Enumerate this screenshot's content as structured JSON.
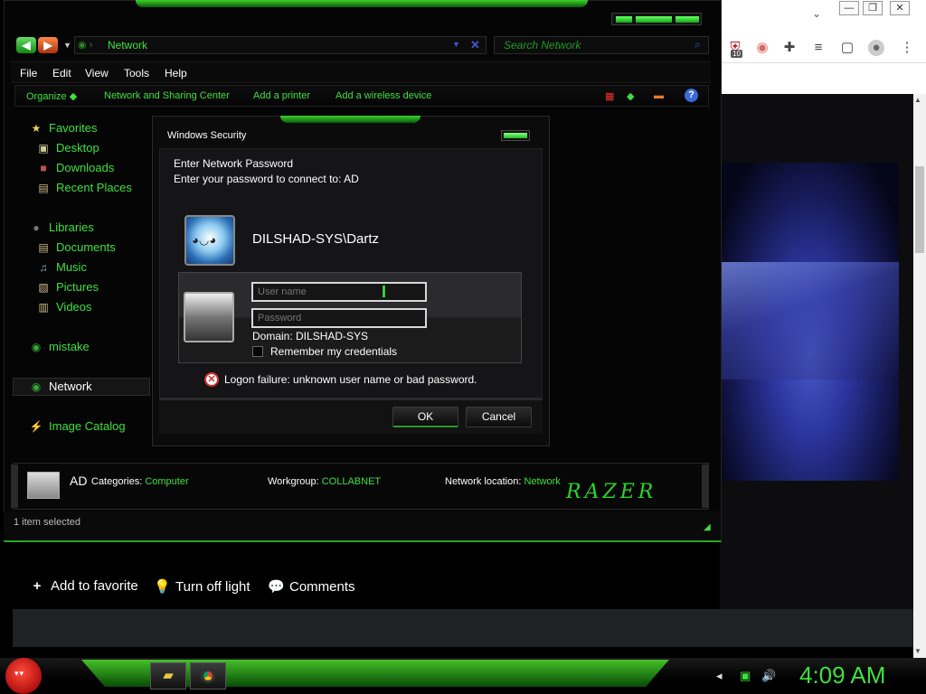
{
  "browser": {
    "window_controls": {
      "minimize": "—",
      "restore": "❐",
      "close": "✕"
    },
    "extension_badge": "10",
    "scroll_up": "▲",
    "scroll_down": "▼",
    "page_actions": {
      "add_favorite": "Add to favorite",
      "turn_off_light": "Turn off light",
      "comments": "Comments"
    }
  },
  "explorer": {
    "address": "Network",
    "search_placeholder": "Search Network",
    "menus": [
      "File",
      "Edit",
      "View",
      "Tools",
      "Help"
    ],
    "commands": [
      "Organize",
      "Network and Sharing Center",
      "Add a printer",
      "Add a wireless device"
    ],
    "help_icon": "?",
    "sidebar": {
      "favorites": "Favorites",
      "desktop": "Desktop",
      "downloads": "Downloads",
      "recent": "Recent Places",
      "libraries": "Libraries",
      "documents": "Documents",
      "music": "Music",
      "pictures": "Pictures",
      "videos": "Videos",
      "homegroup_user": "mistake",
      "network": "Network",
      "image_catalog": "Image Catalog"
    },
    "details": {
      "name": "AD",
      "categories_label": "Categories:",
      "categories_value": "Computer",
      "workgroup_label": "Workgroup:",
      "workgroup_value": "COLLABNET",
      "location_label": "Network location:",
      "location_value": "Network",
      "brand": "RAZER"
    },
    "status": "1 item selected"
  },
  "dialog": {
    "title": "Windows Security",
    "heading": "Enter Network Password",
    "subheading": "Enter your password to connect to: AD",
    "saved_user": "DILSHAD-SYS\\Dartz",
    "username_placeholder": "User name",
    "password_placeholder": "Password",
    "domain": "Domain: DILSHAD-SYS",
    "remember": "Remember my credentials",
    "error": "Logon failure: unknown user name or bad password.",
    "ok": "OK",
    "cancel": "Cancel"
  },
  "taskbar": {
    "clock": "4:09 AM"
  },
  "colors": {
    "accent": "#3ee03e",
    "error": "#d62b2b"
  }
}
